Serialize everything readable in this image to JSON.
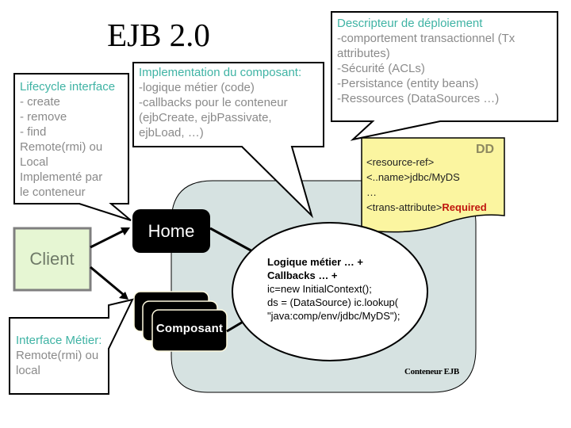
{
  "title": "EJB 2.0",
  "callouts": {
    "lifecycle": {
      "heading": "Lifecycle interface",
      "lines": [
        "- create",
        "- remove",
        "- find",
        "Remote(rmi) ou",
        "Local",
        "Implementé par",
        "le conteneur"
      ]
    },
    "implementation": {
      "heading": "Implementation du composant:",
      "lines": [
        "-logique métier (code)",
        "-callbacks pour le conteneur",
        "(ejbCreate, ejbPassivate,",
        "ejbLoad, …)"
      ]
    },
    "descriptor": {
      "heading": "Descripteur de déploiement",
      "lines": [
        "-comportement transactionnel (Tx",
        "attributes)",
        "-Sécurité (ACLs)",
        "-Persistance (entity beans)",
        "-Ressources (DataSources …)"
      ]
    },
    "business_interface": {
      "heading": "Interface Métier:",
      "lines": [
        "Remote(rmi) ou",
        "local"
      ]
    }
  },
  "dd_document": {
    "badge": "DD",
    "line1": "<resource-ref>",
    "line2": "<..name>jdbc/MyDS",
    "line3": "…",
    "line4_prefix": "<trans-attribute>",
    "line4_value": "Required"
  },
  "nodes": {
    "client": "Client",
    "home": "Home",
    "component": "Composant"
  },
  "bean_logic": {
    "bold1": "Logique métier … +",
    "bold2": "Callbacks … +",
    "code1": "ic=new InitialContext();",
    "code2": "ds = (DataSource) ic.lookup(",
    "code3": "\"java:comp/env/jdbc/MyDS\");"
  },
  "container_label": "Conteneur EJB",
  "colors": {
    "heading_teal": "#3fb3a4",
    "body_gray": "#8a8a8a",
    "container_fill": "#d6e2e1",
    "dd_fill": "#fbf5a0",
    "client_fill": "#e6f6d3",
    "required_red": "#c0160e"
  }
}
